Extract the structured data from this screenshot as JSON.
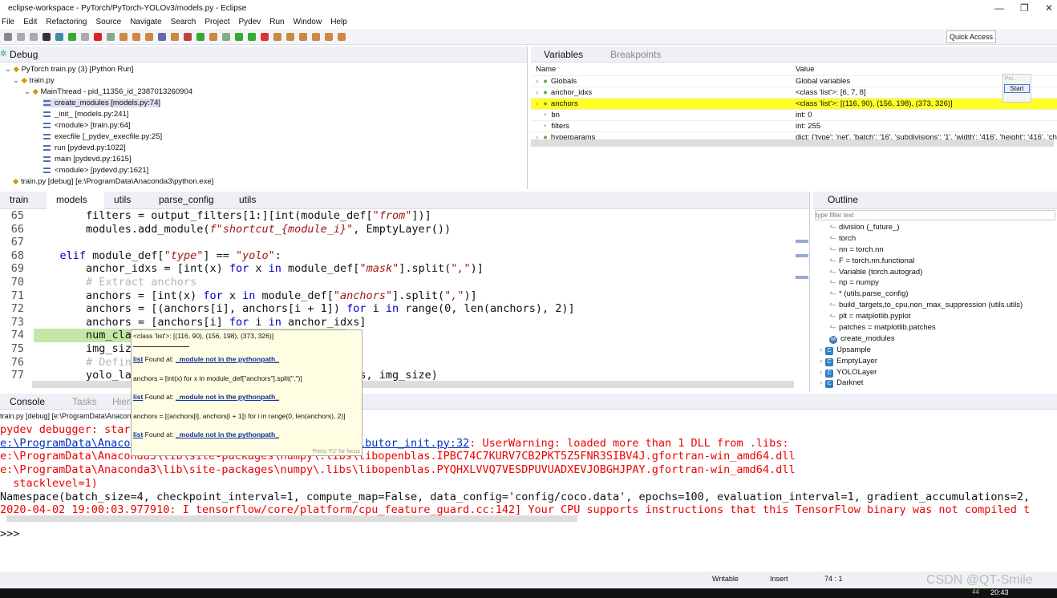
{
  "window": {
    "title": "eclipse-workspace - PyTorch/PyTorch-YOLOv3/models.py - Eclipse"
  },
  "menu": [
    "File",
    "Edit",
    "Refactoring",
    "Source",
    "Navigate",
    "Search",
    "Project",
    "Pydev",
    "Run",
    "Window",
    "Help"
  ],
  "toolbar": {
    "quick_access": "Quick Access"
  },
  "debug": {
    "tab": "Debug",
    "items": [
      {
        "label": "PyTorch train.py (3) [Python Run]",
        "level": 0
      },
      {
        "label": "train.py",
        "level": 1
      },
      {
        "label": "MainThread - pid_11356_id_2387013260904",
        "level": 2
      },
      {
        "label": "create_modules [models.py:74]",
        "level": 3
      },
      {
        "label": "_init_ [models.py:241]",
        "level": 3
      },
      {
        "label": "<module> [train.py:64]",
        "level": 3
      },
      {
        "label": "execfile [_pydev_execfile.py:25]",
        "level": 3
      },
      {
        "label": "run [pydevd.py:1022]",
        "level": 3
      },
      {
        "label": "main [pydevd.py:1615]",
        "level": 3
      },
      {
        "label": "<module> [pydevd.py:1621]",
        "level": 3
      },
      {
        "label": "train.py [debug] [e:\\ProgramData\\Anaconda3\\python.exe]",
        "level": 1
      }
    ]
  },
  "variables": {
    "tab": "Variables",
    "tab2": "Breakpoints",
    "col_name": "Name",
    "col_value": "Value",
    "rows": [
      {
        "name": "Globals",
        "value": "Global variables"
      },
      {
        "name": "anchor_idxs",
        "value": "<class 'list'>: [6, 7, 8]"
      },
      {
        "name": "anchors",
        "value": "<class 'list'>: [(116, 90), (156, 198), (373, 326)]"
      },
      {
        "name": "bn",
        "value": "int: 0"
      },
      {
        "name": "filters",
        "value": "int: 255"
      },
      {
        "name": "hyperparams",
        "value": "dict: {'type': 'net', 'batch': '16', 'subdivisions': '1', 'width': '416', 'height': '416', 'ch"
      }
    ],
    "popup": {
      "field": "Poi...",
      "button": "Start"
    }
  },
  "editor": {
    "tabs": [
      "train",
      "models",
      "utils",
      "parse_config",
      "utils"
    ],
    "active_tab": 1,
    "lines": [
      {
        "n": "65",
        "code": "        filters = output_filters[1:][int(module_def[\"from\"])]"
      },
      {
        "n": "66",
        "code": "        modules.add_module(f\"shortcut_{module_i}\", EmptyLayer())"
      },
      {
        "n": "67",
        "code": ""
      },
      {
        "n": "68",
        "code": "    elif module_def[\"type\"] == \"yolo\":"
      },
      {
        "n": "69",
        "code": "        anchor_idxs = [int(x) for x in module_def[\"mask\"].split(\",\")]"
      },
      {
        "n": "70",
        "code": "        # Extract anchors"
      },
      {
        "n": "71",
        "code": "        anchors = [int(x) for x in module_def[\"anchors\"].split(\",\")]"
      },
      {
        "n": "72",
        "code": "        anchors = [(anchors[i], anchors[i + 1]) for i in range(0, len(anchors), 2)]"
      },
      {
        "n": "73",
        "code": "        anchors = [anchors[i] for i in anchor_idxs]"
      },
      {
        "n": "74",
        "code": "        num_classes = int(module_def[\"classes\"])"
      },
      {
        "n": "75",
        "code": "        img_size = int(hyperparams[\"height\"])"
      },
      {
        "n": "76",
        "code": "        # Define detection layer"
      },
      {
        "n": "77",
        "code": "        yolo_layer = YOLOLayer(anchors, num_classes, img_size)"
      }
    ]
  },
  "tooltip": {
    "value": "<class 'list'>: [(116, 90), (156, 198), (373, 326)]",
    "found_label": "list",
    "found_text": "Found at:",
    "found_link": "_module not in the pythonpath_",
    "def1": "anchors = [int(x) for x in module_def[\"anchors\"].split(\",\")]",
    "def2": "anchors = [(anchors[i], anchors[i + 1]) for i in range(0, len(anchors), 2)]",
    "hint": "Press 'F2' for focus"
  },
  "outline": {
    "tab": "Outline",
    "filter_placeholder": "type filter text",
    "items": [
      {
        "label": "division (_future_)",
        "kind": "import"
      },
      {
        "label": "torch",
        "kind": "import"
      },
      {
        "label": "nn = torch.nn",
        "kind": "import"
      },
      {
        "label": "F = torch.nn.functional",
        "kind": "import"
      },
      {
        "label": "Variable (torch.autograd)",
        "kind": "import"
      },
      {
        "label": "np = numpy",
        "kind": "import"
      },
      {
        "label": "* (utils.parse_config)",
        "kind": "import"
      },
      {
        "label": "build_targets,to_cpu,non_max_suppression (utils.utils)",
        "kind": "import"
      },
      {
        "label": "plt = matplotlib.pyplot",
        "kind": "import"
      },
      {
        "label": "patches = matplotlib.patches",
        "kind": "import"
      },
      {
        "label": "create_modules",
        "kind": "method"
      },
      {
        "label": "Upsample",
        "kind": "class"
      },
      {
        "label": "EmptyLayer",
        "kind": "class"
      },
      {
        "label": "YOLOLayer",
        "kind": "class"
      },
      {
        "label": "Darknet",
        "kind": "class"
      }
    ]
  },
  "console": {
    "tabs": [
      "Console",
      "Tasks",
      "Hierarchy"
    ],
    "launch": "train.py [debug] [e:\\ProgramData\\Anaconda3\\python.exe]",
    "lines": [
      {
        "text": "pydev debugger: starting (pid: 11356)",
        "color": "red"
      },
      {
        "link": "e:\\ProgramData\\Anaconda3\\lib\\site-packages\\numpy\\_distributor_init.py:32",
        "text": ": UserWarning: loaded more than 1 DLL from .libs:",
        "color": "red"
      },
      {
        "text": "e:\\ProgramData\\Anaconda3\\lib\\site-packages\\numpy\\.libs\\libopenblas.IPBC74C7KURV7CB2PKT5Z5FNR3SIBV4J.gfortran-win_amd64.dll",
        "color": "red"
      },
      {
        "text": "e:\\ProgramData\\Anaconda3\\lib\\site-packages\\numpy\\.libs\\libopenblas.PYQHXLVVQ7VESDPUVUADXEVJOBGHJPAY.gfortran-win_amd64.dll",
        "color": "red"
      },
      {
        "text": "  stacklevel=1)",
        "color": "red"
      },
      {
        "text": "Namespace(batch_size=4, checkpoint_interval=1, compute_map=False, data_config='config/coco.data', epochs=100, evaluation_interval=1, gradient_accumulations=2,",
        "color": "black"
      },
      {
        "text": "2020-04-02 19:00:03.977910: I tensorflow/core/platform/cpu_feature_guard.cc:142] Your CPU supports instructions that this TensorFlow binary was not compiled t",
        "color": "red"
      }
    ],
    "prompt": ">>>"
  },
  "status": {
    "writable": "Writable",
    "insert": "Insert",
    "position": "74 : 1"
  },
  "taskbar": {
    "time": "20:43",
    "badge": "44"
  },
  "watermark": "CSDN @QT-Smile",
  "colors": {
    "highlight": "#ffff22",
    "current_line": "#c6e6a8",
    "console_error": "#e00000",
    "keyword": "#0000c0"
  }
}
